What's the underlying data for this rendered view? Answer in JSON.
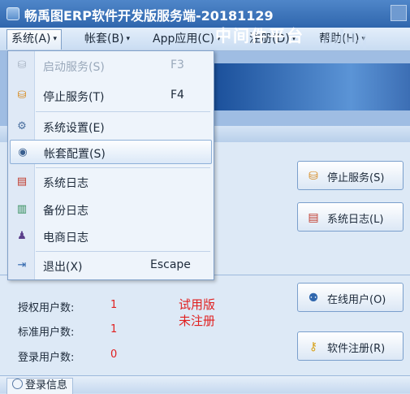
{
  "window": {
    "title": "畅禹图ERP软件开发版服务端-20181129"
  },
  "menubar": {
    "items": [
      {
        "label": "系统(A)"
      },
      {
        "label": "帐套(B)"
      },
      {
        "label": "App应用(C)"
      },
      {
        "label": "注册(D)"
      },
      {
        "label": "帮助(H)"
      }
    ]
  },
  "dropdown": {
    "items": [
      {
        "label": "启动服务(S)",
        "shortcut": "F3",
        "enabled": false,
        "icon": "start-service-icon"
      },
      {
        "label": "停止服务(T)",
        "shortcut": "F4",
        "icon": "stop-service-icon"
      },
      {
        "label": "系统设置(E)",
        "shortcut": "",
        "icon": "settings-icon"
      },
      {
        "label": "帐套配置(S)",
        "shortcut": "",
        "highlighted": true,
        "icon": "account-config-icon"
      },
      {
        "label": "系统日志",
        "shortcut": "",
        "icon": "log-icon"
      },
      {
        "label": "备份日志",
        "shortcut": "",
        "icon": "backup-icon"
      },
      {
        "label": "电商日志",
        "shortcut": "",
        "icon": "ecommerce-icon"
      },
      {
        "label": "退出(X)",
        "shortcut": "Escape",
        "icon": "exit-icon"
      }
    ]
  },
  "banner": {
    "text": "中间件平台"
  },
  "buttons": {
    "stop_service": "停止服务(S)",
    "system_log": "系统日志(L)",
    "online_users": "在线用户(O)",
    "software_register": "软件注册(R)"
  },
  "stats": {
    "licensed_label": "授权用户数:",
    "licensed_value": "1",
    "standard_label": "标准用户数:",
    "standard_value": "1",
    "logged_label": "登录用户数:",
    "logged_value": "0"
  },
  "trial": {
    "line1": "试用版",
    "line2": "未注册"
  },
  "statusbar": {
    "tab_label": "登录信息"
  },
  "colors": {
    "accent": "#2f66ad",
    "alert": "#e02020"
  }
}
